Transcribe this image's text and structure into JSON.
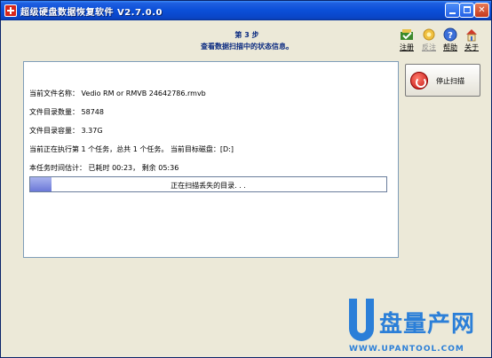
{
  "window": {
    "title": "超级硬盘数据恢复软件 V2.7.0.0",
    "colors": {
      "titlebar": "#0b4fd8",
      "accent": "#0a2a80",
      "progress": "#6b78d8"
    }
  },
  "step": {
    "title": "第 3 步",
    "subtitle": "查看数据扫描中的状态信息。"
  },
  "toolbar": {
    "items": [
      {
        "label": "注册",
        "icon": "register-icon",
        "enabled": true
      },
      {
        "label": "反注",
        "icon": "unregister-icon",
        "enabled": false
      },
      {
        "label": "帮助",
        "icon": "help-icon",
        "enabled": true
      },
      {
        "label": "关于",
        "icon": "about-icon",
        "enabled": true
      }
    ]
  },
  "info": {
    "current_file": "当前文件名称： Vedio RM or RMVB 24642786.rmvb",
    "file_count": "文件目录数量： 58748",
    "file_size": "文件目录容量： 3.37G",
    "task_status": "当前正在执行第 1 个任务，总共 1 个任务。 当前目标磁盘：[D:]",
    "time_estimate": "本任务时间估计： 已耗时 00:23， 剩余 05:36"
  },
  "progress": {
    "text": "正在扫描丢失的目录. . .",
    "fraction": 0.06
  },
  "stop_button": {
    "label": "停止扫描"
  },
  "watermark": {
    "text_cn": "盘量产网",
    "url": "WWW.UPANTOOL.COM"
  }
}
